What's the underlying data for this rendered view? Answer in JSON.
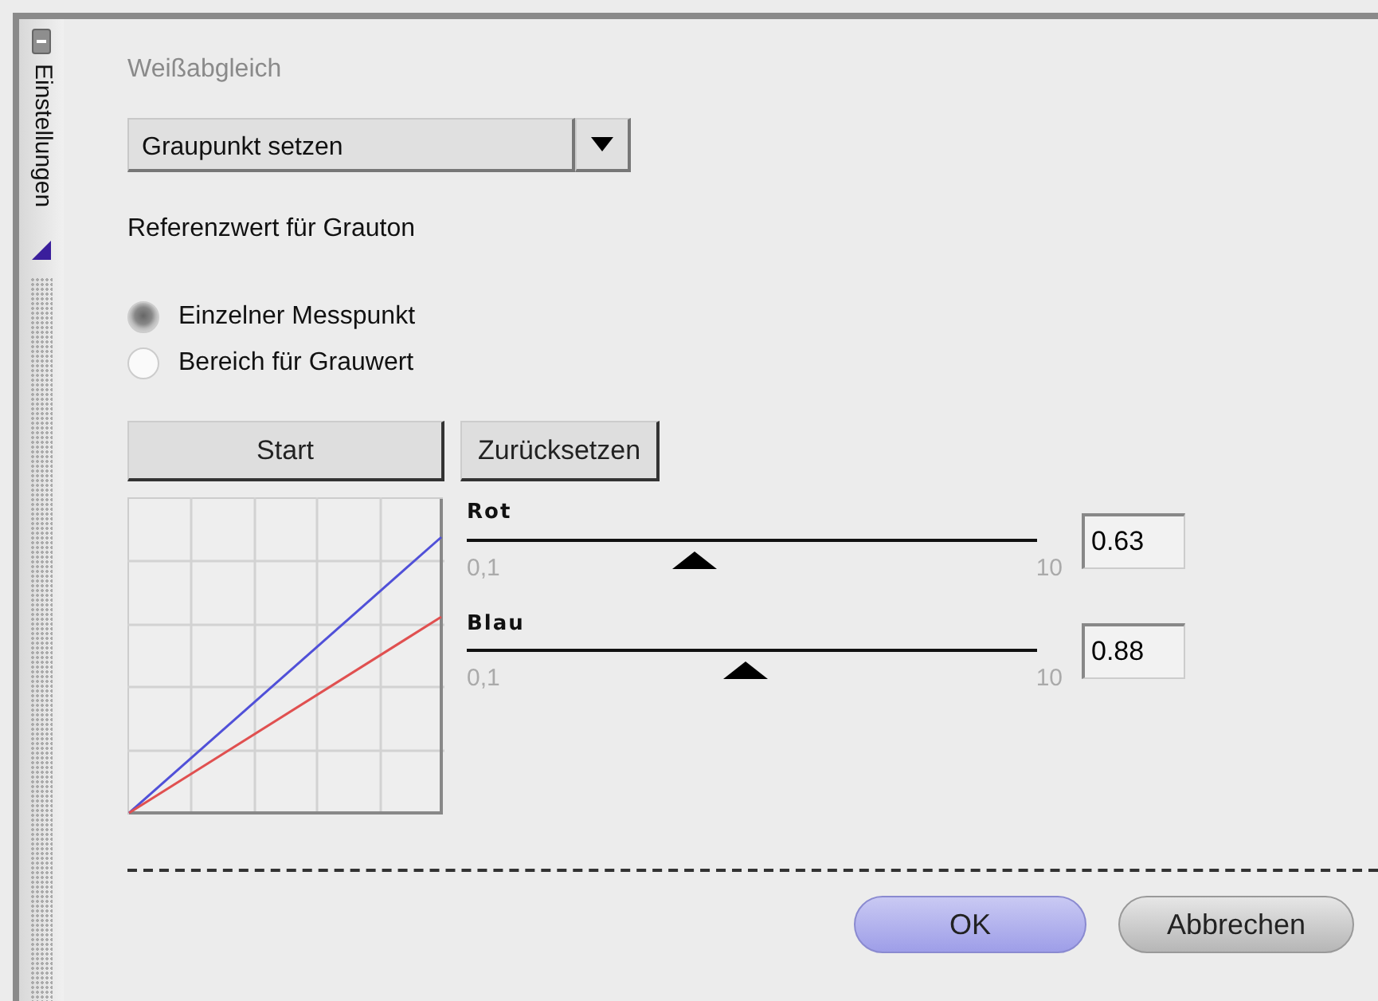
{
  "side_panel": {
    "title": "Einstellungen"
  },
  "section_title": "Weißabgleich",
  "mode_select": {
    "value": "Graupunkt setzen"
  },
  "reference_label": "Referenzwert für Grauton",
  "radios": [
    {
      "label": "Einzelner Messpunkt",
      "selected": true
    },
    {
      "label": "Bereich für Grauwert",
      "selected": false
    }
  ],
  "action_buttons": [
    "Start",
    "Zurücksetzen"
  ],
  "sliders": [
    {
      "name": "Rot",
      "min_label": "0,1",
      "max_label": "10",
      "level": 0.4,
      "value": "0.63"
    },
    {
      "name": "Blau",
      "min_label": "0,1",
      "max_label": "10",
      "level": 0.49,
      "value": "0.88"
    }
  ],
  "dialog_buttons": [
    {
      "label": "OK",
      "kind": "primary"
    },
    {
      "label": "Abbrechen",
      "kind": "secondary"
    }
  ]
}
